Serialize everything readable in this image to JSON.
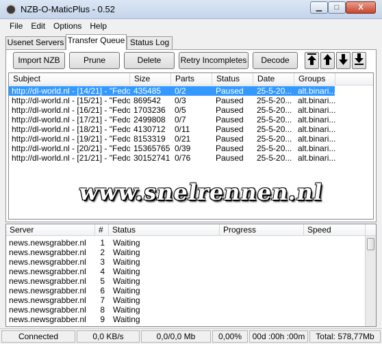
{
  "window": {
    "title": "NZB-O-MaticPlus - 0.52",
    "controls": {
      "minimize": "▁",
      "maximize": "□",
      "close": "X"
    }
  },
  "menu": [
    "File",
    "Edit",
    "Options",
    "Help"
  ],
  "tabs": [
    {
      "label": "Usenet Servers",
      "active": false
    },
    {
      "label": "Transfer Queue",
      "active": true
    },
    {
      "label": "Status Log",
      "active": false
    }
  ],
  "toolbar": {
    "import": "Import NZB",
    "prune": "Prune",
    "delete": "Delete",
    "retry": "Retry Incompletes",
    "decode": "Decode",
    "move_icons": [
      "move-top-icon",
      "move-up-icon",
      "move-down-icon",
      "move-bottom-icon"
    ]
  },
  "queue": {
    "columns": [
      "Subject",
      "Size",
      "Parts",
      "Status",
      "Date",
      "Groups"
    ],
    "rows": [
      {
        "subject": "http://dl-world.nl - [14/21] - \"Fedo...",
        "size": "435485",
        "parts": "0/2",
        "status": "Paused",
        "date": "25-5-20...",
        "groups": "alt.binari...",
        "selected": true
      },
      {
        "subject": "http://dl-world.nl - [15/21] - \"Fedo...",
        "size": "869542",
        "parts": "0/3",
        "status": "Paused",
        "date": "25-5-20...",
        "groups": "alt.binari..."
      },
      {
        "subject": "http://dl-world.nl - [16/21] - \"Fedo...",
        "size": "1703236",
        "parts": "0/5",
        "status": "Paused",
        "date": "25-5-20...",
        "groups": "alt.binari..."
      },
      {
        "subject": "http://dl-world.nl - [17/21] - \"Fedo...",
        "size": "2499808",
        "parts": "0/7",
        "status": "Paused",
        "date": "25-5-20...",
        "groups": "alt.binari..."
      },
      {
        "subject": "http://dl-world.nl - [18/21] - \"Fedo...",
        "size": "4130712",
        "parts": "0/11",
        "status": "Paused",
        "date": "25-5-20...",
        "groups": "alt.binari..."
      },
      {
        "subject": "http://dl-world.nl - [19/21] - \"Fedo...",
        "size": "8153319",
        "parts": "0/21",
        "status": "Paused",
        "date": "25-5-20...",
        "groups": "alt.binari..."
      },
      {
        "subject": "http://dl-world.nl - [20/21] - \"Fedo...",
        "size": "15365765",
        "parts": "0/39",
        "status": "Paused",
        "date": "25-5-20...",
        "groups": "alt.binari..."
      },
      {
        "subject": "http://dl-world.nl - [21/21] - \"Fedo...",
        "size": "30152741",
        "parts": "0/76",
        "status": "Paused",
        "date": "25-5-20...",
        "groups": "alt.binari..."
      }
    ]
  },
  "watermark": "www.snelrennen.nl",
  "connections": {
    "columns": [
      "Server",
      "#",
      "Status",
      "Progress",
      "Speed"
    ],
    "rows": [
      {
        "server": "news.newsgrabber.nl",
        "num": "1",
        "status": "Waiting"
      },
      {
        "server": "news.newsgrabber.nl",
        "num": "2",
        "status": "Waiting"
      },
      {
        "server": "news.newsgrabber.nl",
        "num": "3",
        "status": "Waiting"
      },
      {
        "server": "news.newsgrabber.nl",
        "num": "4",
        "status": "Waiting"
      },
      {
        "server": "news.newsgrabber.nl",
        "num": "5",
        "status": "Waiting"
      },
      {
        "server": "news.newsgrabber.nl",
        "num": "6",
        "status": "Waiting"
      },
      {
        "server": "news.newsgrabber.nl",
        "num": "7",
        "status": "Waiting"
      },
      {
        "server": "news.newsgrabber.nl",
        "num": "8",
        "status": "Waiting"
      },
      {
        "server": "news.newsgrabber.nl",
        "num": "9",
        "status": "Waiting"
      }
    ]
  },
  "statusbar": {
    "connection": "Connected",
    "speed": "0,0 KB/s",
    "transfer": "0,0/0,0 Mb",
    "percent": "0,00%",
    "eta": "00d :00h :00m",
    "total": "Total: 578,77Mb"
  },
  "colors": {
    "selection": "#3399ff",
    "title_gradient_top": "#dbe6f4"
  }
}
